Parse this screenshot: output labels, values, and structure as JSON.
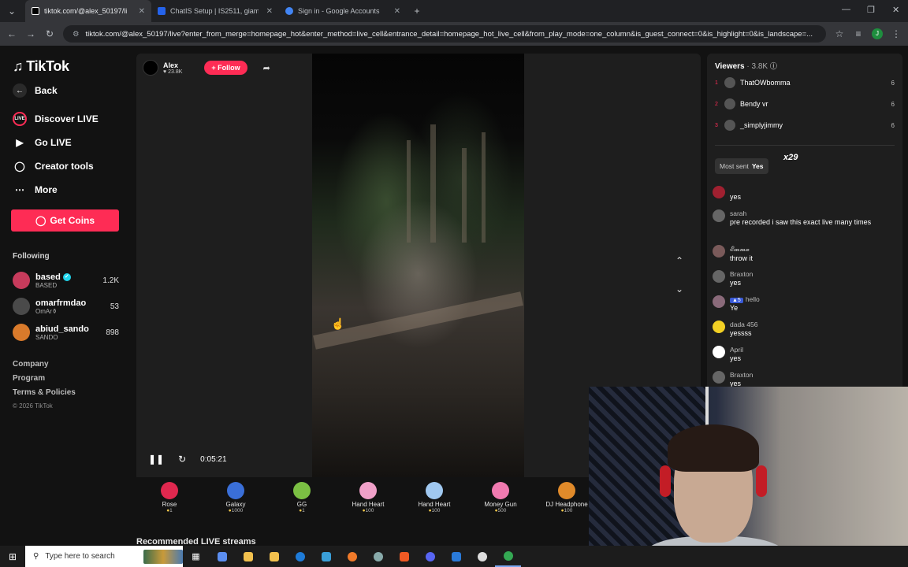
{
  "browser": {
    "tabs": [
      {
        "title": "tiktok.com/@alex_50197/li",
        "active": true,
        "color": "#000000"
      },
      {
        "title": "ChatIS Setup | IS2511, giambaJ",
        "active": false,
        "color": "#2563eb"
      },
      {
        "title": "Sign in - Google Accounts",
        "active": false,
        "color": "#4285f4"
      }
    ],
    "new_tab": "+",
    "url": "tiktok.com/@alex_50197/live?enter_from_merge=homepage_hot&enter_method=live_cell&entrance_detail=homepage_hot_live_cell&from_play_mode=one_column&is_guest_connect=0&is_highlight=0&is_landscape=..."
  },
  "sidebar": {
    "logo": "TikTok",
    "back": "Back",
    "nav": [
      {
        "label": "Discover LIVE",
        "icon": "live-icon"
      },
      {
        "label": "Go LIVE",
        "icon": "camera-icon"
      },
      {
        "label": "Creator tools",
        "icon": "creator-tools-icon"
      },
      {
        "label": "More",
        "icon": "more-icon"
      }
    ],
    "get_coins": "Get Coins",
    "following_label": "Following",
    "following": [
      {
        "name": "based",
        "sub": "BASED",
        "count": "1.2K",
        "color": "#c73b5c",
        "verified": true
      },
      {
        "name": "omarfrmdao",
        "sub": "OmAr⚱",
        "count": "53",
        "color": "#4a4a4a",
        "verified": false
      },
      {
        "name": "abiud_sando",
        "sub": "SANDO",
        "count": "898",
        "color": "#d97a2b",
        "verified": false
      }
    ],
    "footer": [
      "Company",
      "Program",
      "Terms & Policies"
    ],
    "copyright": "© 2026 TikTok"
  },
  "stream": {
    "host_name": "Alex",
    "host_likes": "♥ 23.8K",
    "follow": "+ Follow",
    "time": "0:05:21",
    "gifts": [
      {
        "name": "Rose",
        "price": "1",
        "color": "#e0284f"
      },
      {
        "name": "Galaxy",
        "price": "1000",
        "color": "#3a6fd8"
      },
      {
        "name": "GG",
        "price": "1",
        "color": "#7bc043"
      },
      {
        "name": "Hand Heart",
        "price": "100",
        "color": "#f0a0c8"
      },
      {
        "name": "Hand Heart",
        "price": "100",
        "color": "#a0c8f0"
      },
      {
        "name": "Money Gun",
        "price": "500",
        "color": "#f07ab0"
      },
      {
        "name": "DJ Headphone",
        "price": "100",
        "color": "#e08a2a"
      }
    ],
    "recommended": "Recommended LIVE streams"
  },
  "panel": {
    "viewers_label": "Viewers",
    "viewers_count": "· 3.8K",
    "top_viewers": [
      {
        "rank": "1",
        "name": "ThatOWbomma",
        "score": "6"
      },
      {
        "rank": "2",
        "name": "Bendy vr",
        "score": "6"
      },
      {
        "rank": "3",
        "name": "_simplyjimmy",
        "score": "6"
      }
    ],
    "most_sent_label": "Most sent",
    "most_sent_value": "Yes",
    "most_sent_times": "x29",
    "messages": [
      {
        "user": "",
        "text": "yes"
      },
      {
        "user": "sarah",
        "text": "pre recorded i saw this exact live many times"
      },
      {
        "user": "𝓔𝓶𝓶𝓪",
        "text": "throw it"
      },
      {
        "user": "Braxton",
        "text": "yes"
      },
      {
        "user": "hello",
        "text": "Ye"
      },
      {
        "user": "dada 456",
        "text": "yessss"
      },
      {
        "user": "April",
        "text": "yes"
      },
      {
        "user": "Braxton",
        "text": "yes"
      }
    ]
  },
  "taskbar": {
    "search_placeholder": "Type here to search"
  }
}
